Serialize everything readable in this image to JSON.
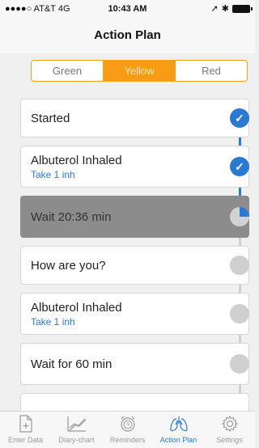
{
  "status": {
    "carrier": "●●●●○ AT&T  4G",
    "time": "10:43 AM"
  },
  "nav": {
    "title": "Action Plan"
  },
  "zones": [
    {
      "label": "Green",
      "selected": false
    },
    {
      "label": "Yellow",
      "selected": true
    },
    {
      "label": "Red",
      "selected": false
    }
  ],
  "steps": [
    {
      "title": "Started",
      "subtitle": "",
      "state": "done"
    },
    {
      "title": "Albuterol Inhaled",
      "subtitle": "Take 1 inh",
      "state": "done"
    },
    {
      "title": "Wait 20:36 min",
      "subtitle": "",
      "state": "in-progress"
    },
    {
      "title": "How are you?",
      "subtitle": "",
      "state": "pending"
    },
    {
      "title": "Albuterol Inhaled",
      "subtitle": "Take 1 inh",
      "state": "pending"
    },
    {
      "title": "Wait for 60 min",
      "subtitle": "",
      "state": "pending"
    }
  ],
  "tabs": [
    {
      "label": "Enter Data",
      "icon": "enter-data-icon"
    },
    {
      "label": "Diary-chart",
      "icon": "diary-chart-icon"
    },
    {
      "label": "Reminders",
      "icon": "reminders-icon"
    },
    {
      "label": "Action Plan",
      "icon": "lungs-icon"
    },
    {
      "label": "Settings",
      "icon": "gear-icon"
    }
  ],
  "colors": {
    "accent": "#f79c14",
    "blue": "#2a7ad1",
    "active_card": "#8c8c8c"
  }
}
